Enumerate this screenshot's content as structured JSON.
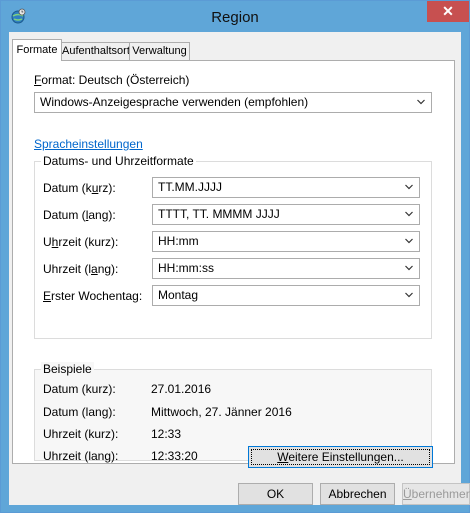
{
  "window": {
    "title": "Region",
    "close_glyph": "✕"
  },
  "tabs": [
    {
      "label": "Formate"
    },
    {
      "label": "Aufenthaltsort"
    },
    {
      "label": "Verwaltung"
    }
  ],
  "format": {
    "label_pre": "",
    "label_accel": "F",
    "label_post": "ormat: Deutsch (Österreich)",
    "combo_value": "Windows-Anzeigesprache verwenden (empfohlen)"
  },
  "language_settings_link": "Spracheinstellungen",
  "date_time_group": {
    "title": "Datums- und Uhrzeitformate",
    "rows": [
      {
        "pre": "Datum (k",
        "accel": "u",
        "post": "rz):",
        "value": "TT.MM.JJJJ"
      },
      {
        "pre": "Datum (",
        "accel": "l",
        "post": "ang):",
        "value": "TTTT, TT. MMMM JJJJ"
      },
      {
        "pre": "U",
        "accel": "h",
        "post": "rzeit (kurz):",
        "value": "HH:mm"
      },
      {
        "pre": "Uhrzeit (l",
        "accel": "a",
        "post": "ng):",
        "value": "HH:mm:ss"
      },
      {
        "pre": "",
        "accel": "E",
        "post": "rster Wochentag:",
        "value": "Montag"
      }
    ]
  },
  "examples_group": {
    "title": "Beispiele",
    "rows": [
      {
        "label": "Datum (kurz):",
        "value": "27.01.2016"
      },
      {
        "label": "Datum (lang):",
        "value": "Mittwoch, 27. Jänner 2016"
      },
      {
        "label": "Uhrzeit (kurz):",
        "value": "12:33"
      },
      {
        "label": "Uhrzeit (lang):",
        "value": "12:33:20"
      }
    ]
  },
  "more_settings_button": {
    "pre": "",
    "accel": "W",
    "post": "eitere Einstellungen..."
  },
  "footer": {
    "ok": "OK",
    "cancel": "Abbrechen",
    "apply_pre": "",
    "apply_accel": "Ü",
    "apply_post": "bernehmen"
  }
}
